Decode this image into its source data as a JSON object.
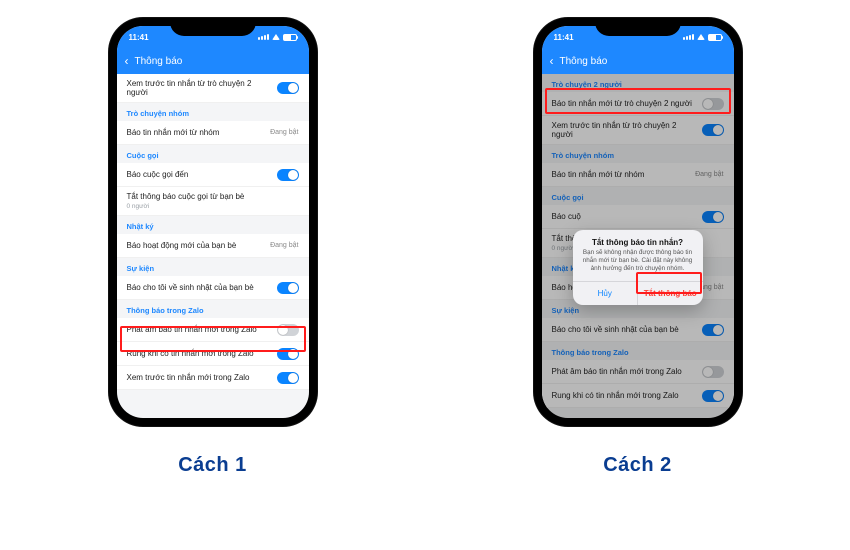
{
  "captions": {
    "left": "Cách 1",
    "right": "Cách 2"
  },
  "statusbar": {
    "time": "11:41"
  },
  "header": {
    "title": "Thông báo"
  },
  "sections": {
    "tro_chuyen_2_nguoi": "Trò chuyện 2 người",
    "tro_chuyen_nhom": "Trò chuyện nhóm",
    "cuoc_goi": "Cuộc gọi",
    "nhat_ky": "Nhật ký",
    "su_kien": "Sự kiện",
    "thong_bao_trong_zalo": "Thông báo trong Zalo"
  },
  "rows": {
    "preview_2p": "Xem trước tin nhắn từ trò chuyện 2 người",
    "notify_2p": "Báo tin nhắn mới từ trò chuyện 2 người",
    "notify_group": "Báo tin nhắn mới từ nhóm",
    "notify_group_state": "Đang bật",
    "incoming_call": "Báo cuộc gọi đến",
    "mute_friend_call": "Tắt thông báo cuộc gọi từ bạn bè",
    "mute_friend_call_sub": "0 người",
    "new_activity": "Báo hoạt động mới của bạn bè",
    "new_activity_state": "Đang bật",
    "birthday": "Báo cho tôi về sinh nhật của bạn bè",
    "sound_new_msg": "Phát âm báo tin nhắn mới trong Zalo",
    "vibrate_new_msg": "Rung khi có tin nhắn mới trong Zalo",
    "preview_in_zalo": "Xem trước tin nhắn mới trong Zalo",
    "bao_cuoc_prefix": "Báo cuộ",
    "tat_tho_prefix": "Tắt thô"
  },
  "dialog": {
    "title": "Tắt thông báo tin nhắn?",
    "body": "Bạn sẽ không nhận được thông báo tin nhắn mới từ bạn bè. Cài đặt này không ảnh hưởng đến trò chuyện nhóm.",
    "cancel": "Hủy",
    "confirm": "Tắt thông báo"
  }
}
